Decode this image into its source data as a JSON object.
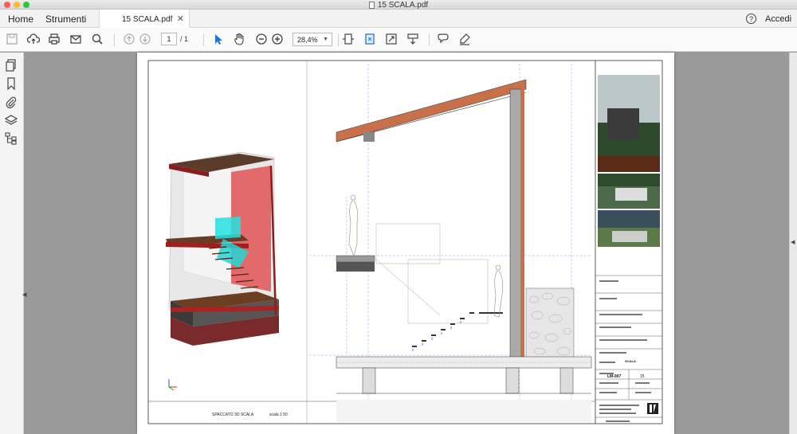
{
  "window": {
    "title": "15 SCALA.pdf"
  },
  "nav": {
    "home": "Home",
    "tools": "Strumenti",
    "sign_in": "Accedi",
    "help_glyph": "?"
  },
  "document_tab": {
    "filename": "15 SCALA.pdf",
    "close_glyph": "✕"
  },
  "toolbar": {
    "icons": [
      "save-icon",
      "upload-icon",
      "print-icon",
      "email-icon",
      "search-icon",
      "page-up-icon",
      "page-down-icon",
      "select-pointer-icon",
      "hand-icon",
      "zoom-out-icon",
      "zoom-in-icon",
      "fit-width-icon",
      "fit-page-icon",
      "fullscreen-icon",
      "scroll-mode-icon",
      "comment-icon",
      "highlight-pen-icon"
    ],
    "page_current": "1",
    "page_total": "/  1",
    "zoom": "28,4%"
  },
  "sidebar": {
    "icons": [
      "pages-icon",
      "bookmark-icon",
      "attachment-icon",
      "layers-icon",
      "structure-icon"
    ]
  },
  "drawing": {
    "view_3d_label": "SPACCATO 3D SCALA",
    "view_3d_scale": "scala 1:50",
    "title_block_code": "LM-007",
    "title_block_sheet": "15",
    "title_block_scale_label": "SCALA"
  }
}
